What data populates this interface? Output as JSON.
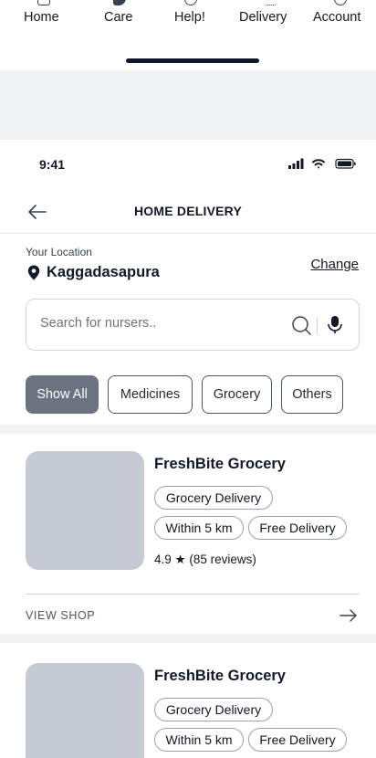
{
  "tabbar": {
    "tabs": [
      {
        "label": "Home",
        "icon": "home-icon"
      },
      {
        "label": "Care",
        "icon": "care-icon"
      },
      {
        "label": "Help!",
        "icon": "help-icon"
      },
      {
        "label": "Delivery",
        "icon": "delivery-icon"
      },
      {
        "label": "Account",
        "icon": "account-icon"
      }
    ]
  },
  "status": {
    "time": "9:41"
  },
  "header": {
    "title": "HOME DELIVERY"
  },
  "location": {
    "label": "Your Location",
    "name": "Kaggadasapura",
    "change_label": "Change"
  },
  "search": {
    "placeholder": "Search for nursers.."
  },
  "filters": [
    {
      "label": "Show All",
      "active": true
    },
    {
      "label": "Medicines",
      "active": false
    },
    {
      "label": "Grocery",
      "active": false
    },
    {
      "label": "Others",
      "active": false
    }
  ],
  "shops": [
    {
      "name": "FreshBite Grocery",
      "tags": [
        "Grocery Delivery",
        "Within 5 km",
        "Free Delivery"
      ],
      "rating": "4.9 ★ (85 reviews)",
      "action": "VIEW SHOP"
    },
    {
      "name": "FreshBite Grocery",
      "tags": [
        "Grocery Delivery",
        "Within 5 km",
        "Free Delivery"
      ]
    }
  ],
  "colors": {
    "active_chip": "#6b7280",
    "thumb": "#c6cbd3",
    "background": "#f2f3f5"
  }
}
